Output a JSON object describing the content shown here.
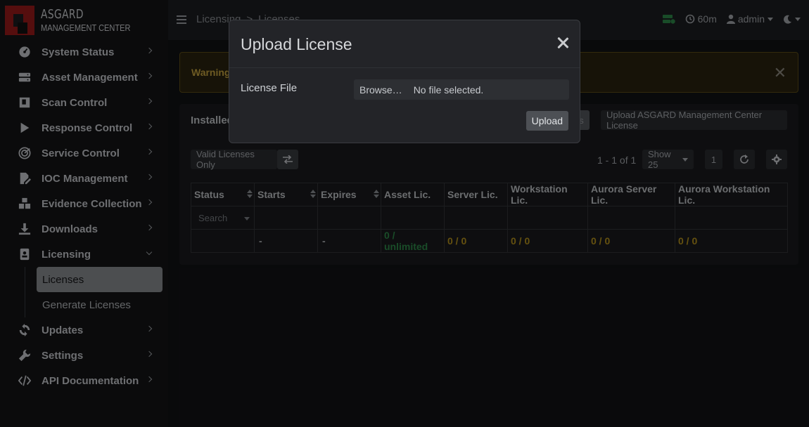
{
  "app": {
    "logo_line1": "ASGARD",
    "logo_line2": "MANAGEMENT CENTER"
  },
  "sidebar": {
    "items": [
      {
        "label": "System Status",
        "icon": "gauge-icon"
      },
      {
        "label": "Asset Management",
        "icon": "server-icon"
      },
      {
        "label": "Scan Control",
        "icon": "scan-icon"
      },
      {
        "label": "Response Control",
        "icon": "play-icon"
      },
      {
        "label": "Service Control",
        "icon": "radar-icon"
      },
      {
        "label": "IOC Management",
        "icon": "file-edit-icon"
      },
      {
        "label": "Evidence Collection",
        "icon": "boxes-icon"
      },
      {
        "label": "Downloads",
        "icon": "download-icon"
      },
      {
        "label": "Licensing",
        "icon": "id-card-icon"
      },
      {
        "label": "Updates",
        "icon": "sync-icon"
      },
      {
        "label": "Settings",
        "icon": "wrench-icon"
      },
      {
        "label": "API Documentation",
        "icon": "code-icon"
      }
    ],
    "licensing_sub": [
      {
        "label": "Licenses",
        "active": true
      },
      {
        "label": "Generate Licenses",
        "active": false
      }
    ]
  },
  "topbar": {
    "crumb1": "Licensing",
    "crumb_sep": ">",
    "crumb2": "Licenses",
    "timer": "60m",
    "user": "admin"
  },
  "alert": {
    "text": "Warning:"
  },
  "card": {
    "title": "Installed",
    "btn_partial": "s",
    "btn_upload_amc": "Upload ASGARD Management Center License",
    "filter_btn": "Valid Licenses Only",
    "pagination": "1 - 1 of 1",
    "page_size": "Show 25",
    "page_number": "1"
  },
  "table": {
    "headers": [
      "Status",
      "Starts",
      "Expires",
      "Asset Lic.",
      "Server Lic.",
      "Workstation Lic.",
      "Aurora Server Lic.",
      "Aurora Workstation Lic."
    ],
    "search_placeholder": "Search",
    "row": {
      "status": "",
      "starts": "-",
      "expires": "-",
      "asset": "0 / unlimited",
      "server": "0 / 0",
      "workstation": "0 / 0",
      "aurora_server": "0 / 0",
      "aurora_workstation": "0 / 0"
    }
  },
  "modal": {
    "title": "Upload License",
    "field_label": "License File",
    "browse_label": "Browse…",
    "file_status": "No file selected.",
    "upload_label": "Upload"
  },
  "colors": {
    "accent_green": "#2f8a4a",
    "accent_amber": "#b8941d",
    "brand_red": "#9c1b1b"
  }
}
